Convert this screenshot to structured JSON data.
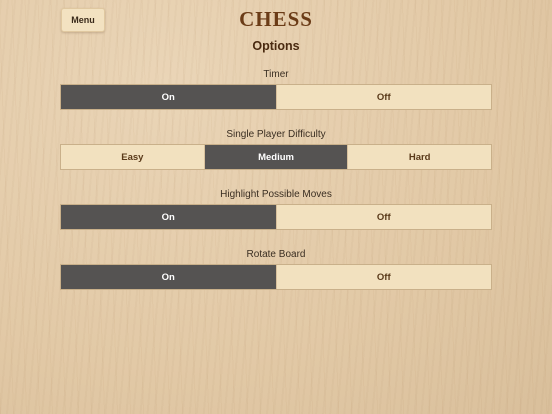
{
  "header": {
    "menu_label": "Menu",
    "app_title": "CHESS",
    "page_title": "Options"
  },
  "options": [
    {
      "label": "Timer",
      "segments": [
        {
          "label": "On",
          "selected": true
        },
        {
          "label": "Off",
          "selected": false
        }
      ]
    },
    {
      "label": "Single Player Difficulty",
      "segments": [
        {
          "label": "Easy",
          "selected": false
        },
        {
          "label": "Medium",
          "selected": true
        },
        {
          "label": "Hard",
          "selected": false
        }
      ]
    },
    {
      "label": "Highlight Possible Moves",
      "segments": [
        {
          "label": "On",
          "selected": true
        },
        {
          "label": "Off",
          "selected": false
        }
      ]
    },
    {
      "label": "Rotate Board",
      "segments": [
        {
          "label": "On",
          "selected": true
        },
        {
          "label": "Off",
          "selected": false
        }
      ]
    }
  ],
  "colors": {
    "selected_segment": "#555352",
    "unselected_segment": "#f2e1bf",
    "title_brown": "#6b3c17"
  }
}
